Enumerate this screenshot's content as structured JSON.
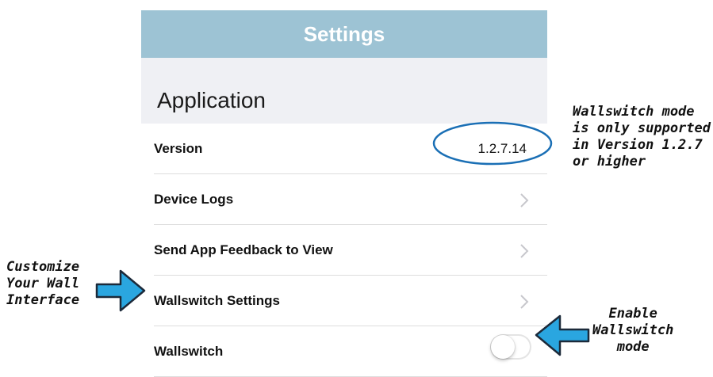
{
  "header": {
    "title": "Settings"
  },
  "section": {
    "title": "Application"
  },
  "rows": {
    "version": {
      "label": "Version",
      "value": "1.2.7.14"
    },
    "device_logs": {
      "label": "Device Logs"
    },
    "feedback": {
      "label": "Send App Feedback to View"
    },
    "wallswitch_settings": {
      "label": "Wallswitch Settings"
    },
    "wallswitch": {
      "label": "Wallswitch",
      "toggle_on": false
    }
  },
  "annotations": {
    "version_note": "Wallswitch mode\nis only supported\nin Version 1.2.7\nor higher",
    "customize_note": "Customize\nYour Wall\nInterface",
    "enable_note": "Enable\nWallswitch\nmode"
  },
  "colors": {
    "header_bg": "#9dc3d4",
    "section_bg": "#eff0f4",
    "arrow_fill": "#2aa6e0",
    "ellipse_stroke": "#1a6fb5"
  }
}
